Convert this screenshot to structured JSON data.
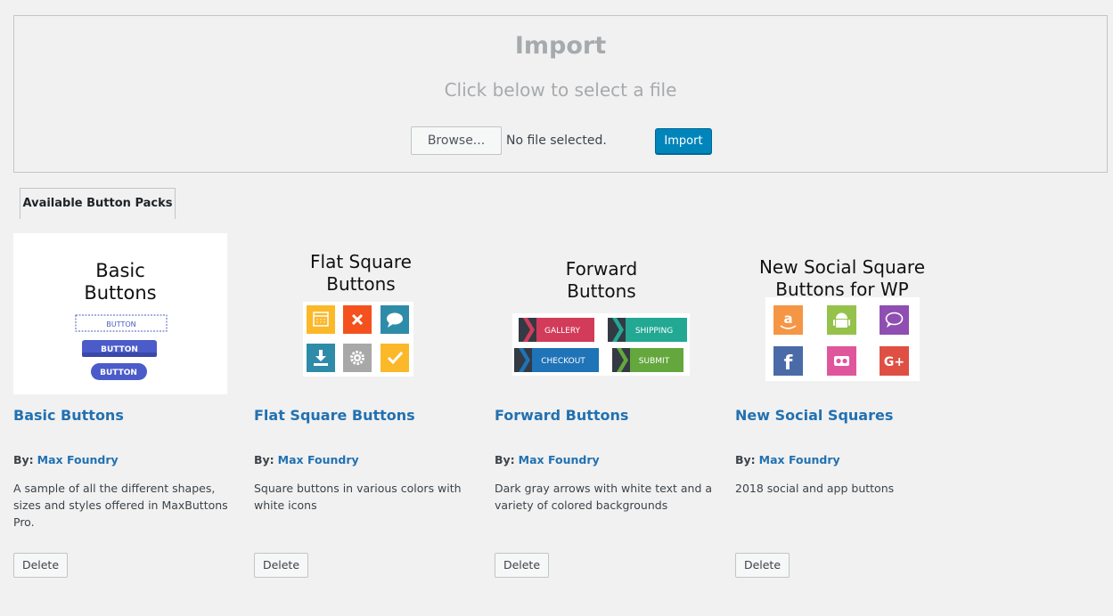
{
  "import": {
    "title": "Import",
    "subtitle": "Click below to select a file",
    "browse_label": "Browse...",
    "file_status": "No file selected.",
    "import_label": "Import"
  },
  "tabs": {
    "active_label": "Available Button Packs"
  },
  "packs": [
    {
      "name": "Basic Buttons",
      "by_label": "By:",
      "author": "Max Foundry",
      "description": "A sample of all the different shapes, sizes and styles offered in MaxButtons Pro.",
      "delete_label": "Delete",
      "preview": {
        "line1": "Basic",
        "line2": "Buttons",
        "btn1": "BUTTON",
        "btn2": "BUTTON",
        "btn3": "BUTTON"
      }
    },
    {
      "name": "Flat Square Buttons",
      "by_label": "By:",
      "author": "Max Foundry",
      "description": "Square buttons in various colors with white icons",
      "delete_label": "Delete",
      "preview": {
        "line1": "Flat Square",
        "line2": "Buttons",
        "icons": [
          "calendar-icon",
          "close-icon",
          "chat-icon",
          "download-icon",
          "gear-icon",
          "check-icon"
        ]
      }
    },
    {
      "name": "Forward Buttons",
      "by_label": "By:",
      "author": "Max Foundry",
      "description": "Dark gray arrows with white text and a variety of colored backgrounds",
      "delete_label": "Delete",
      "preview": {
        "line1": "Forward",
        "line2": "Buttons",
        "btn1": "GALLERY",
        "btn2": "SHIPPING",
        "btn3": "CHECKOUT",
        "btn4": "SUBMIT"
      }
    },
    {
      "name": "New Social Squares",
      "by_label": "By:",
      "author": "Max Foundry",
      "description": "2018 social and app buttons",
      "delete_label": "Delete",
      "preview": {
        "line1": "New Social Square",
        "line2": "Buttons for WP",
        "icons": [
          "amazon-icon",
          "android-icon",
          "speech-bubble-icon",
          "facebook-icon",
          "flickr-icon",
          "google-plus-icon"
        ]
      }
    }
  ],
  "colors": {
    "link": "#2271b1",
    "primary_button": "#0085ba",
    "flat_yellow": "#fbb829",
    "flat_red": "#f4511e",
    "flat_teal": "#2e8ca8",
    "flat_gray": "#a8a8a8",
    "fwd_red": "#d23c5a",
    "fwd_teal": "#23a894",
    "fwd_blue": "#1f73b7",
    "fwd_green": "#64a73d",
    "social_orange": "#f59645",
    "social_green": "#95c24b",
    "social_purple": "#8f4fb2",
    "social_blue": "#4a6ba8",
    "social_pink": "#e0569c",
    "social_red": "#e04f44"
  }
}
